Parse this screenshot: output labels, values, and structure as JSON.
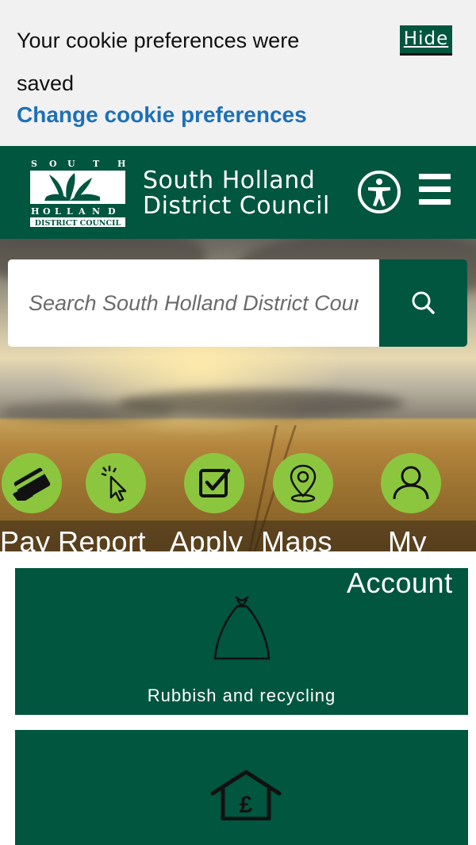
{
  "cookie_banner": {
    "message": "Your cookie preferences were saved",
    "hide_label": "Hide",
    "change_link": "Change cookie preferences"
  },
  "header": {
    "logo_alt": "South Holland District Council",
    "logo_lines": [
      "S O U T H",
      "H O L L A N D",
      "DISTRICT COUNCIL"
    ],
    "title_line1": "South Holland",
    "title_line2": "District Council",
    "accessibility_icon": "accessibility-icon",
    "menu_icon": "hamburger-menu-icon"
  },
  "search": {
    "placeholder": "Search South Holland District Council",
    "button_icon": "search-icon"
  },
  "quick_links": [
    {
      "label": "Pay",
      "icon": "card-payment-icon"
    },
    {
      "label": "Report",
      "icon": "cursor-click-icon"
    },
    {
      "label": "Apply",
      "icon": "checkbox-icon"
    },
    {
      "label": "Maps",
      "icon": "map-pin-icon"
    },
    {
      "label": "My",
      "label2": "Account",
      "icon": "user-icon"
    }
  ],
  "tiles": [
    {
      "label": "Rubbish and recycling",
      "icon": "rubbish-bag-icon"
    },
    {
      "label": "",
      "icon": "house-pound-icon"
    }
  ],
  "colors": {
    "brand_green": "#00563f",
    "accent_green": "#8cc63f",
    "link_blue": "#1d70b8",
    "banner_bg": "#f1f1f1"
  }
}
